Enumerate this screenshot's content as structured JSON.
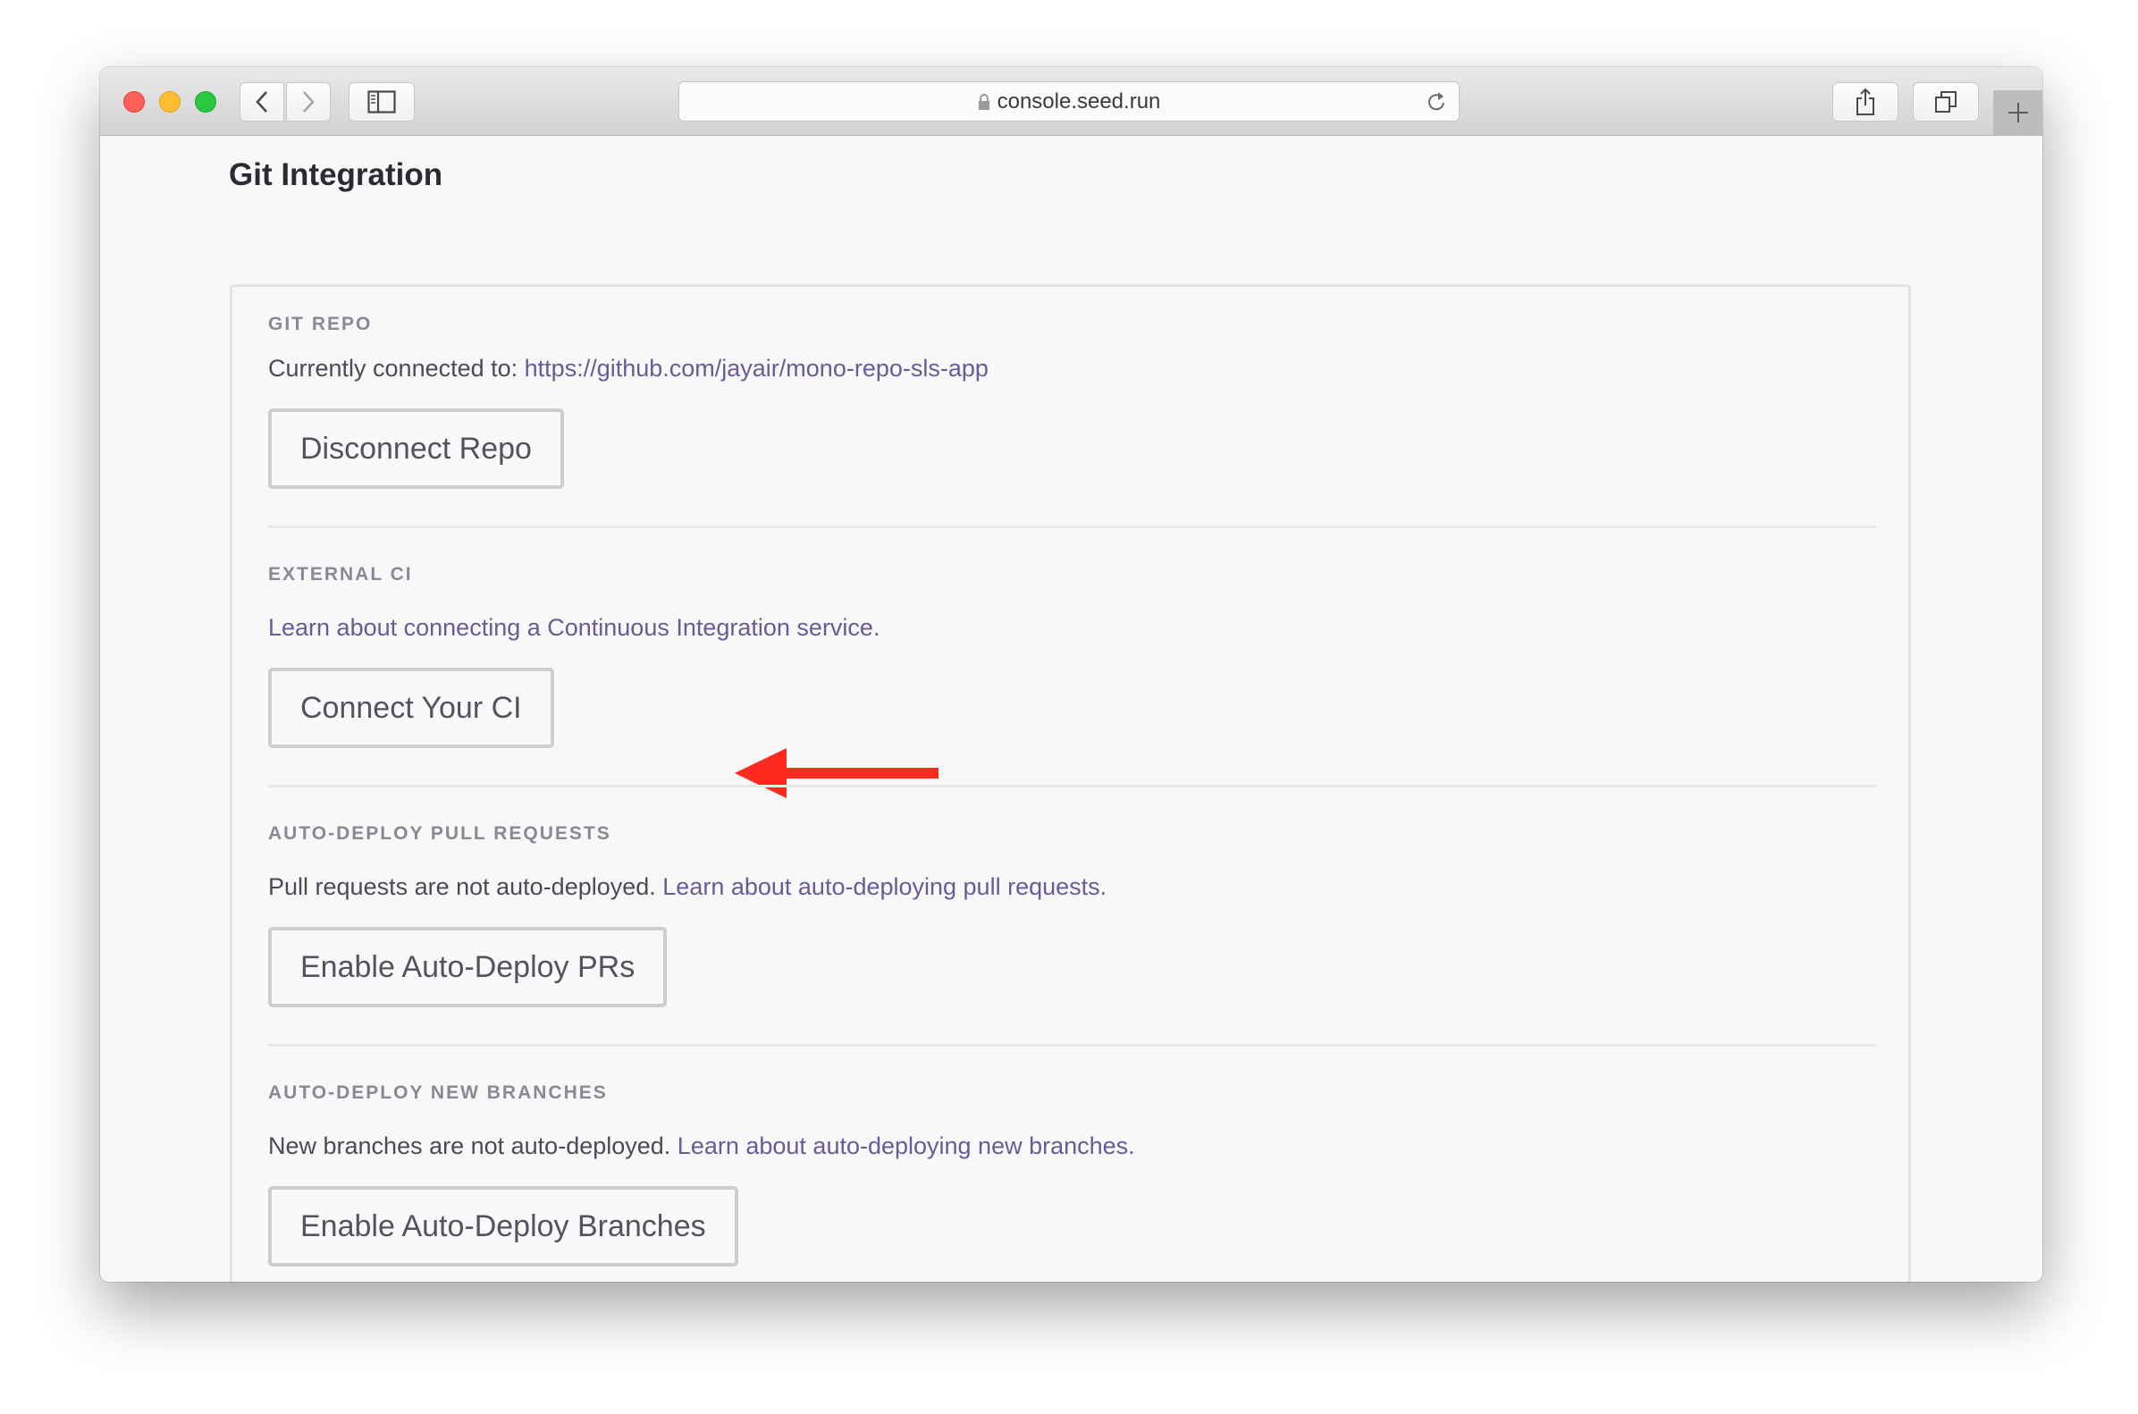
{
  "browser": {
    "url": "console.seed.run",
    "icons": {
      "back": "chevron-left-icon",
      "forward": "chevron-right-icon",
      "sidebar": "sidebar-icon",
      "lock": "lock-icon",
      "reload": "reload-icon",
      "share": "share-icon",
      "tabs": "tabs-icon",
      "new_tab": "plus-icon"
    }
  },
  "page": {
    "title": "Git Integration",
    "sections": [
      {
        "label": "GIT REPO",
        "text": "Currently connected to: ",
        "link": "https://github.com/jayair/mono-repo-sls-app",
        "button": "Disconnect Repo"
      },
      {
        "label": "EXTERNAL CI",
        "text": "",
        "link": "Learn about connecting a Continuous Integration service.",
        "button": "Connect Your CI"
      },
      {
        "label": "AUTO-DEPLOY PULL REQUESTS",
        "text": "Pull requests are not auto-deployed. ",
        "link": "Learn about auto-deploying pull requests.",
        "button": "Enable Auto-Deploy PRs"
      },
      {
        "label": "AUTO-DEPLOY NEW BRANCHES",
        "text": "New branches are not auto-deployed. ",
        "link": "Learn about auto-deploying new branches.",
        "button": "Enable Auto-Deploy Branches"
      }
    ]
  },
  "annotation": {
    "type": "arrow",
    "points_to": "Connect Your CI",
    "color": "#ff2a1f"
  },
  "colors": {
    "link": "#6a5a96",
    "text": "#4d4a56",
    "label": "#8b8895",
    "title": "#2c2a33"
  }
}
